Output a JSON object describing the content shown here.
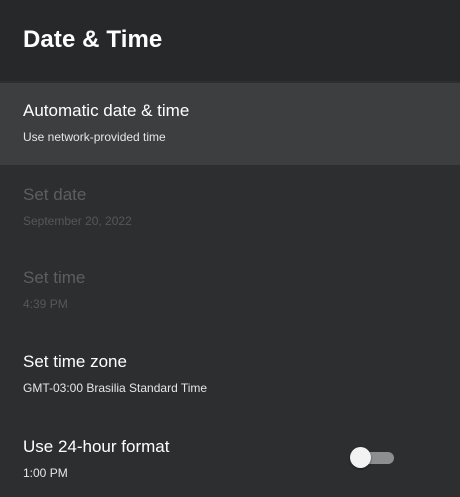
{
  "header": {
    "title": "Date & Time"
  },
  "items": [
    {
      "title": "Automatic date & time",
      "subtitle": "Use network-provided time",
      "state": "focused"
    },
    {
      "title": "Set date",
      "subtitle": "September 20, 2022",
      "state": "disabled"
    },
    {
      "title": "Set time",
      "subtitle": "4:39 PM",
      "state": "disabled"
    },
    {
      "title": "Set time zone",
      "subtitle": "GMT-03:00 Brasilia Standard Time",
      "state": "enabled"
    },
    {
      "title": "Use 24-hour format",
      "subtitle": "1:00 PM",
      "state": "enabled",
      "toggle_on": false
    }
  ],
  "colors": {
    "background": "#2c2e30",
    "header_background": "#262829",
    "focused_background": "#3c3e40",
    "disabled_text": "#5c5e60",
    "toggle_track_off": "#8c8e90",
    "toggle_thumb": "#f2f2f2"
  }
}
